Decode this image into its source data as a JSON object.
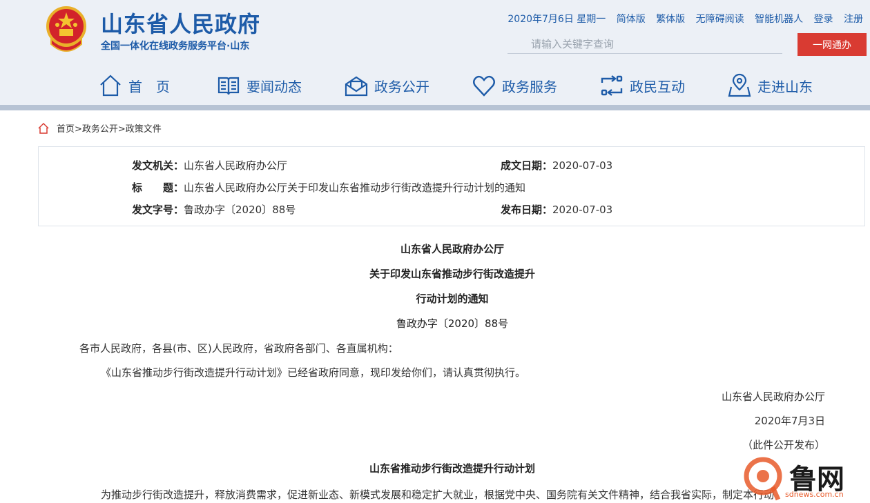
{
  "site": {
    "title": "山东省人民政府",
    "subtitle": "全国一体化在线政务服务平台·山东"
  },
  "top_links": {
    "date": "2020年7月6日 星期一",
    "simplified": "简体版",
    "traditional": "繁体版",
    "accessible": "无障碍阅读",
    "robot": "智能机器人",
    "login": "登录",
    "register": "注册"
  },
  "search": {
    "placeholder": "请输入关键字查询",
    "button": "一网通办"
  },
  "nav": [
    {
      "label": "首　页"
    },
    {
      "label": "要闻动态"
    },
    {
      "label": "政务公开"
    },
    {
      "label": "政务服务"
    },
    {
      "label": "政民互动"
    },
    {
      "label": "走进山东"
    }
  ],
  "breadcrumb": "首页>政务公开>政策文件",
  "meta": {
    "issuer_label": "发文机关：",
    "issuer": "山东省人民政府办公厅",
    "created_label": "成文日期：",
    "created": "2020-07-03",
    "title_label": "标　　题：",
    "title": "山东省人民政府办公厅关于印发山东省推动步行街改造提升行动计划的通知",
    "docno_label": "发文字号：",
    "docno": "鲁政办字〔2020〕88号",
    "published_label": "发布日期：",
    "published": "2020-07-03"
  },
  "doc": {
    "heading1": "山东省人民政府办公厅",
    "heading2": "关于印发山东省推动步行街改造提升",
    "heading3": "行动计划的通知",
    "number": "鲁政办字〔2020〕88号",
    "recipients": "各市人民政府，各县(市、区)人民政府，省政府各部门、各直属机构：",
    "body1": "《山东省推动步行街改造提升行动计划》已经省政府同意，现印发给你们，请认真贯彻执行。",
    "sign_org": "山东省人民政府办公厅",
    "sign_date": "2020年7月3日",
    "note": "（此件公开发布）",
    "plan_title": "山东省推动步行街改造提升行动计划",
    "plan_intro": "为推动步行街改造提升，释放消费需求，促进新业态、新模式发展和稳定扩大就业，根据党中央、国务院有关文件精神，结合我省实际，制定本行动"
  },
  "watermark": {
    "text": "鲁网",
    "url": "sdnews.com.cn"
  },
  "colors": {
    "brand_blue": "#1d5ba8",
    "search_red": "#d93b32",
    "header_bg": "#ecf0f6"
  }
}
